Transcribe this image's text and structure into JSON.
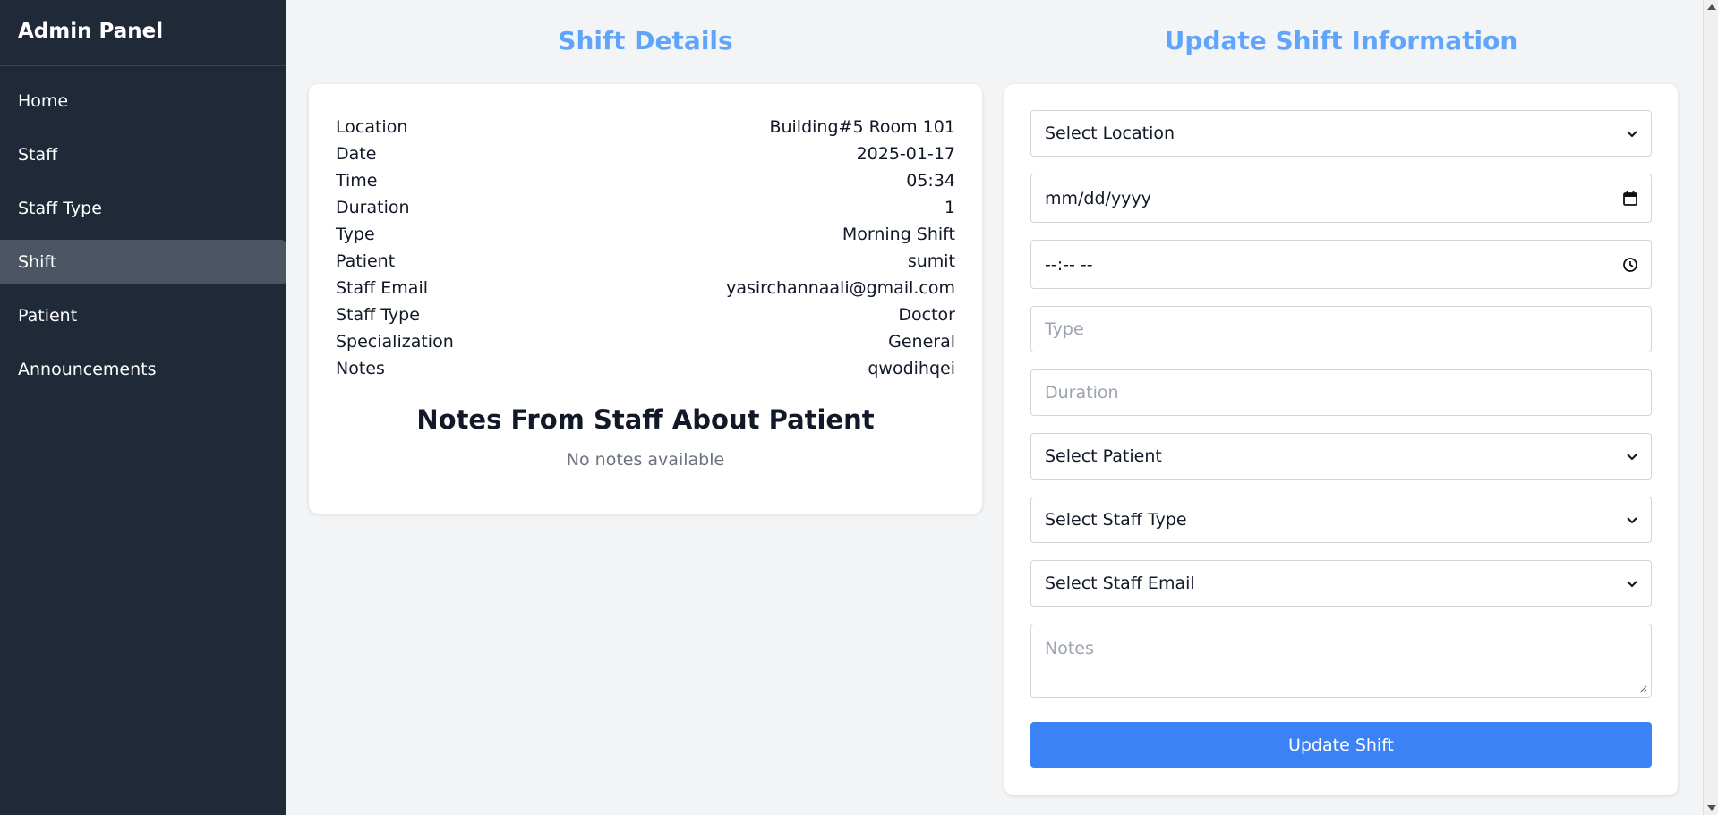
{
  "sidebar": {
    "brand": "Admin Panel",
    "items": [
      {
        "label": "Home"
      },
      {
        "label": "Staff"
      },
      {
        "label": "Staff Type"
      },
      {
        "label": "Shift",
        "active": true
      },
      {
        "label": "Patient"
      },
      {
        "label": "Announcements"
      }
    ]
  },
  "details": {
    "title": "Shift Details",
    "rows": [
      {
        "label": "Location",
        "value": "Building#5 Room 101"
      },
      {
        "label": "Date",
        "value": "2025-01-17"
      },
      {
        "label": "Time",
        "value": "05:34"
      },
      {
        "label": "Duration",
        "value": "1"
      },
      {
        "label": "Type",
        "value": "Morning Shift"
      },
      {
        "label": "Patient",
        "value": "sumit"
      },
      {
        "label": "Staff Email",
        "value": "yasirchannaali@gmail.com"
      },
      {
        "label": "Staff Type",
        "value": "Doctor"
      },
      {
        "label": "Specialization",
        "value": "General"
      },
      {
        "label": "Notes",
        "value": "qwodihqei"
      }
    ],
    "notes_heading": "Notes From Staff About Patient",
    "no_notes": "No notes available"
  },
  "form": {
    "title": "Update Shift Information",
    "location_select": "Select Location",
    "date_value": "mm/dd/yyyy",
    "time_value": "--:-- --",
    "type_placeholder": "Type",
    "duration_placeholder": "Duration",
    "patient_select": "Select Patient",
    "staff_type_select": "Select Staff Type",
    "staff_email_select": "Select Staff Email",
    "notes_placeholder": "Notes",
    "submit_label": "Update Shift"
  },
  "colors": {
    "sidebar_bg": "#1f2937",
    "accent_title": "#60a5fa",
    "button_bg": "#3b82f6"
  }
}
